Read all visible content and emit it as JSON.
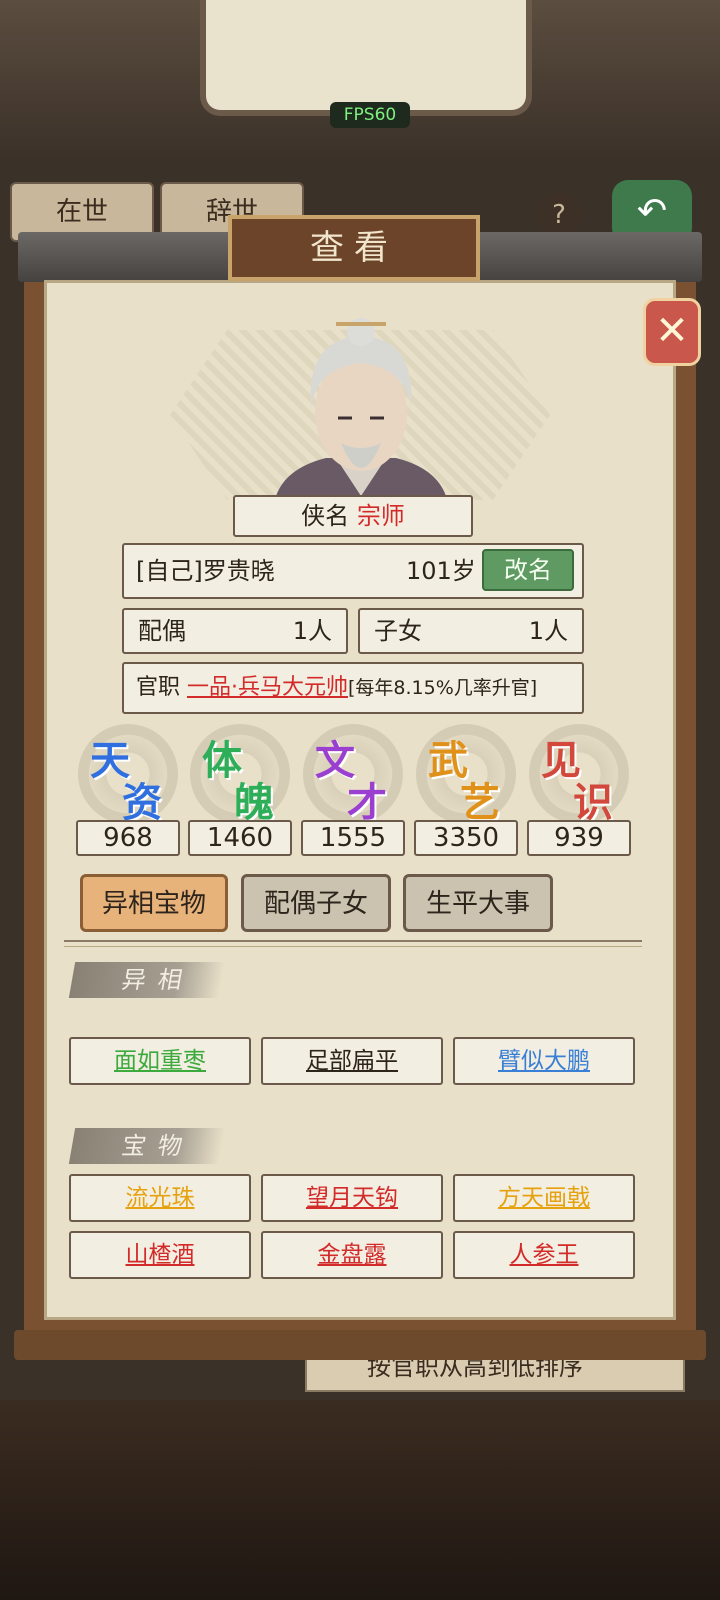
{
  "background": {
    "fps": "FPS60",
    "tab_alive": "在世",
    "tab_dead": "辞世",
    "sort_label": "按官职从高到低排序"
  },
  "dialog": {
    "title": "查看",
    "close_icon": "close-x-icon"
  },
  "character": {
    "title_label": "侠名",
    "title_value": "宗师",
    "name": "[自己]罗贵晓",
    "age": "101岁",
    "rename_label": "改名",
    "spouse_label": "配偶",
    "spouse_value": "1人",
    "children_label": "子女",
    "children_value": "1人",
    "office_label": "官职",
    "office_value": "一品·兵马大元帅",
    "office_note": "[每年8.15%几率升官]"
  },
  "stats": [
    {
      "glyph_top": "天",
      "glyph_bottom": "资",
      "value": "968",
      "color": "#2f6fe0"
    },
    {
      "glyph_top": "体",
      "glyph_bottom": "魄",
      "value": "1460",
      "color": "#2fae5a"
    },
    {
      "glyph_top": "文",
      "glyph_bottom": "才",
      "value": "1555",
      "color": "#9b3fd1"
    },
    {
      "glyph_top": "武",
      "glyph_bottom": "艺",
      "value": "3350",
      "color": "#e0911a"
    },
    {
      "glyph_top": "见",
      "glyph_bottom": "识",
      "value": "939",
      "color": "#d2483c"
    }
  ],
  "tabs": [
    "异相宝物",
    "配偶子女",
    "生平大事"
  ],
  "traits_header": "异相",
  "traits": [
    "面如重枣",
    "足部扁平",
    "臂似大鹏"
  ],
  "treasures_header": "宝物",
  "treasures": [
    "流光珠",
    "望月天钩",
    "方天画戟",
    "山楂酒",
    "金盘露",
    "人参王"
  ],
  "colors": {
    "trait_colors": [
      "#3daa3d",
      "#2d241c",
      "#3a7fd6"
    ],
    "treasure_colors": [
      "#e6a20e",
      "#d32a2a",
      "#e6a20e",
      "#d32a2a",
      "#d32a2a",
      "#d32a2a"
    ]
  }
}
